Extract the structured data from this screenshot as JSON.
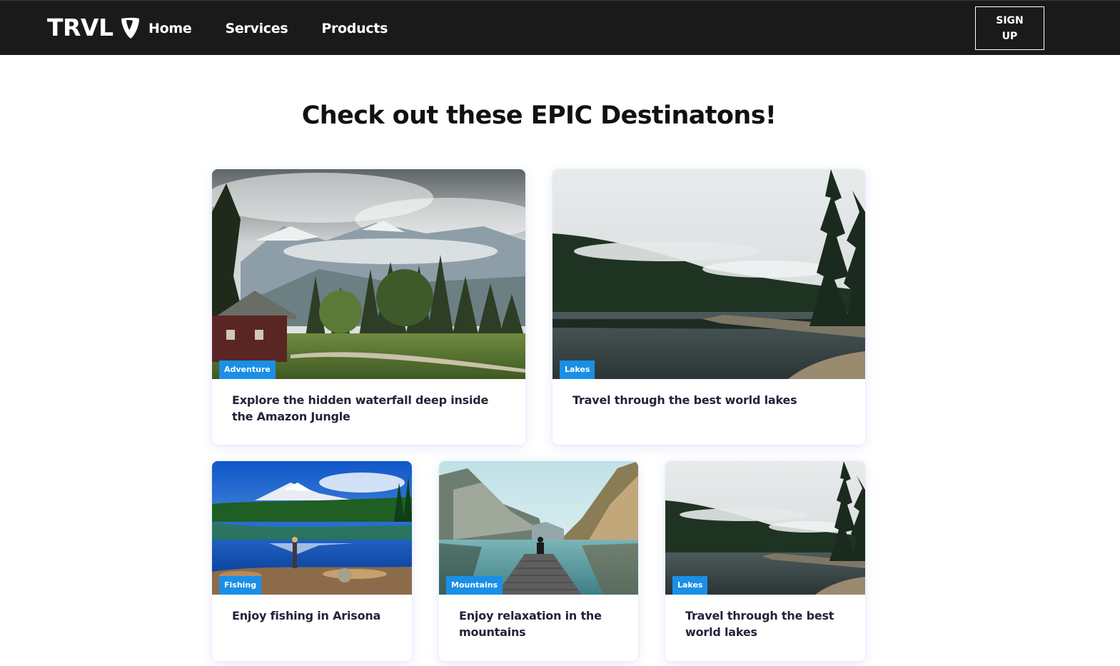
{
  "nav": {
    "brand": "TRVL",
    "brand_icon": "typo3-logo-icon",
    "links": [
      "Home",
      "Services",
      "Products"
    ],
    "signup_line1": "SIGN",
    "signup_line2": "UP"
  },
  "main": {
    "title": "Check out these EPIC Destinatons!"
  },
  "cards": [
    {
      "tag": "Adventure",
      "title": "Explore the hidden waterfall deep inside the Amazon Jungle"
    },
    {
      "tag": "Lakes",
      "title": "Travel through the best world lakes"
    },
    {
      "tag": "Fishing",
      "title": "Enjoy fishing in Arisona"
    },
    {
      "tag": "Mountains",
      "title": "Enjoy relaxation in the mountains"
    },
    {
      "tag": "Lakes",
      "title": "Travel through the best world lakes"
    }
  ],
  "colors": {
    "navbar_bg": "#1b1a1a",
    "badge_bg": "#1a8fe8",
    "title_text": "#111111",
    "card_text": "#23233a"
  }
}
